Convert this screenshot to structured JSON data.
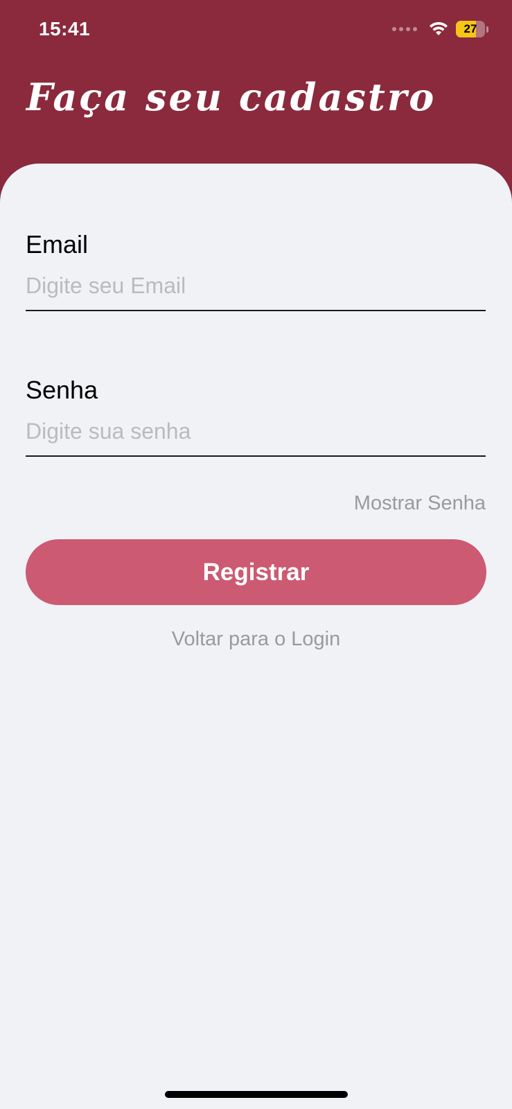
{
  "status_bar": {
    "time": "15:41",
    "battery_level": "27",
    "battery_color": "#f5c518"
  },
  "header": {
    "title": "Faça seu cadastro",
    "background_color": "#8b2a3d"
  },
  "form": {
    "email": {
      "label": "Email",
      "placeholder": "Digite seu Email",
      "value": ""
    },
    "password": {
      "label": "Senha",
      "placeholder": "Digite sua senha",
      "value": ""
    },
    "show_password_label": "Mostrar Senha",
    "register_label": "Registrar",
    "register_color": "#cb5a72",
    "back_to_login_label": "Voltar para o Login"
  },
  "icons": {
    "signal": "cellular-signal-icon",
    "wifi": "wifi-icon",
    "battery": "battery-icon"
  }
}
